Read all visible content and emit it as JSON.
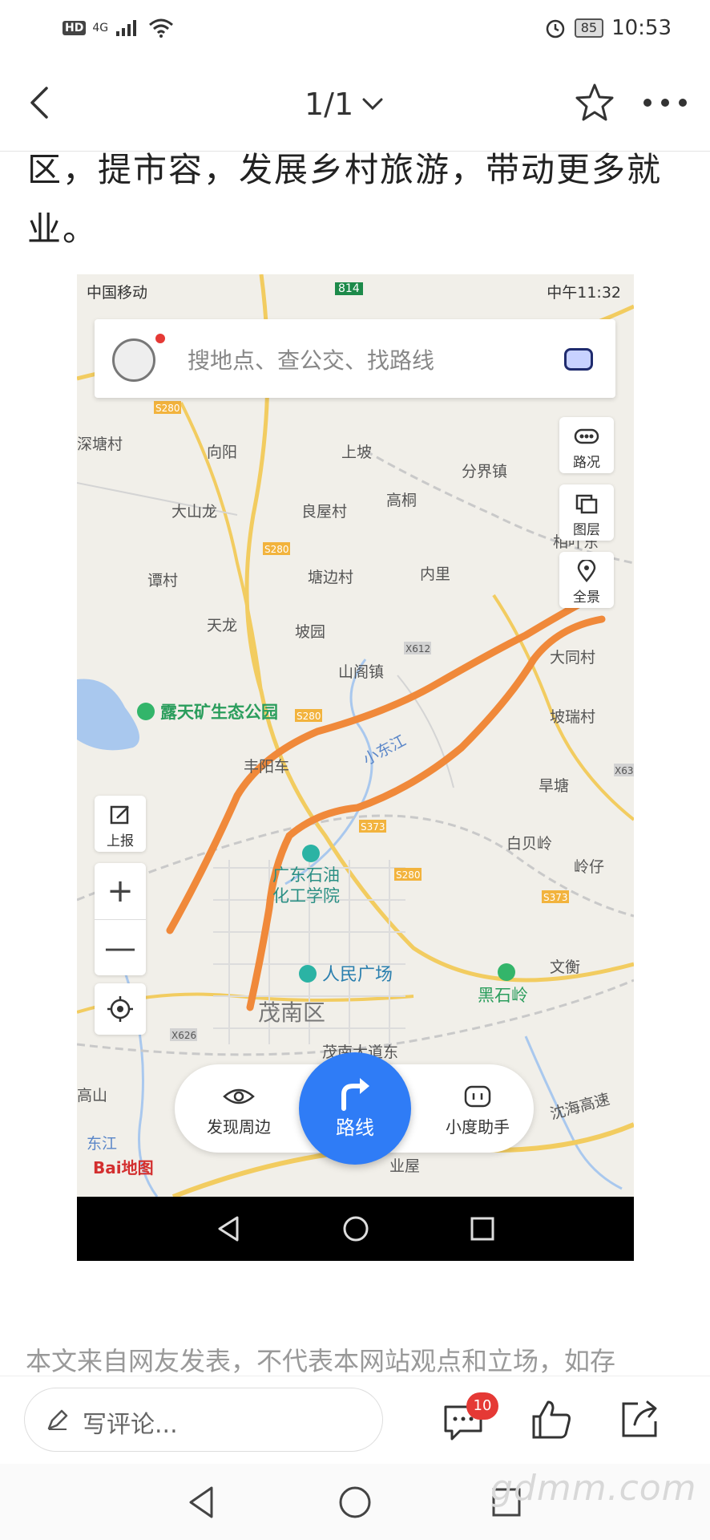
{
  "status_bar": {
    "hd": "HD",
    "network": "4G",
    "battery": "85",
    "time": "10:53"
  },
  "header": {
    "pager": "1/1"
  },
  "article": {
    "text": "区，提市容，发展乡村旅游，带动更多就业。"
  },
  "embedded_screenshot": {
    "status": {
      "carrier": "中国移动",
      "badge": "814",
      "time": "中午11:32"
    },
    "search_placeholder": "搜地点、查公交、找路线",
    "side_buttons": {
      "traffic": "路况",
      "layers": "图层",
      "panorama": "全景",
      "report": "上报",
      "zoom_in": "+",
      "zoom_out": "—"
    },
    "map_labels": [
      "深塘村",
      "向阳",
      "上坡",
      "分界镇",
      "大山龙",
      "良屋村",
      "高桐",
      "谭村",
      "塘边村",
      "内里",
      "相叶东",
      "天龙",
      "坡园",
      "山阁镇",
      "大同村",
      "露天矿生态公园",
      "坡瑞村",
      "小东江",
      "丰阳车",
      "旱塘",
      "白贝岭",
      "广东石油化工学院",
      "人民广场",
      "茂南区",
      "黑石岭",
      "文衡",
      "茂南大道东",
      "沈海高速",
      "业屋",
      "东江",
      "高山",
      "岭仔"
    ],
    "road_codes": [
      "S280",
      "S280",
      "S280",
      "X612",
      "S373",
      "S280",
      "S373",
      "X626",
      "X63"
    ],
    "bottom": {
      "discover": "发现周边",
      "route": "路线",
      "assistant": "小度助手"
    },
    "logo": "Bai地图"
  },
  "disclaimer": "本文来自网友发表，不代表本网站观点和立场，如存",
  "bottom_bar": {
    "comment_placeholder": "写评论...",
    "comment_count": "10"
  },
  "watermark": "gdmm.com",
  "colors": {
    "route_overlay": "#f0893a",
    "route_button": "#2f7cf6",
    "badge_red": "#e53935"
  }
}
